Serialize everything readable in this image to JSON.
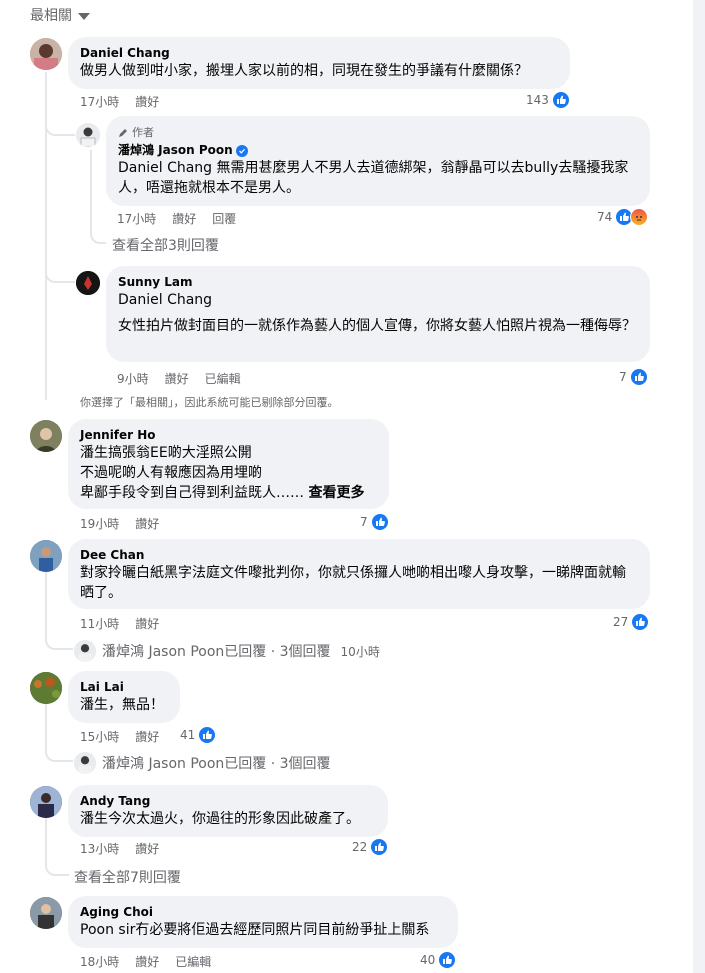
{
  "sort": {
    "label": "最相關"
  },
  "comments": [
    {
      "name": "Daniel Chang",
      "text": "做男人做到咁小家，搬埋人家以前的相，同現在發生的爭議有什麼關係？",
      "time": "17小時",
      "like_label": "讚好",
      "reactions": "143"
    },
    {
      "author_tag": "作者",
      "name": "潘焯鴻 Jason Poon",
      "text": "Daniel Chang 無需用甚麼男人不男人去道德綁架，翁靜晶可以去bully去騷擾我家人，唔還拖就根本不是男人。",
      "time": "17小時",
      "like_label": "讚好",
      "reply_label": "回覆",
      "reactions": "74"
    },
    {
      "view_replies": "查看全部3則回覆"
    },
    {
      "name": "Sunny Lam",
      "mention": "Daniel Chang",
      "text": "女性拍片做封面目的一就係作為藝人的個人宣傳，你將女藝人怕照片視為一種侮辱？",
      "time": "9小時",
      "like_label": "讚好",
      "edited": "已編輯",
      "reactions": "7"
    },
    {
      "notice": "你選擇了「最相關」，因此系統可能已剔除部分回覆。"
    },
    {
      "name": "Jennifer Ho",
      "line1": "潘生搞張翁EE啲大淫照公開",
      "line2": "不過呢啲人有報應因為用埋啲",
      "line3": "卑鄙手段令到自己得到利益既人……",
      "see_more": "查看更多",
      "time": "19小時",
      "like_label": "讚好",
      "reactions": "7"
    },
    {
      "name": "Dee Chan",
      "text": "對家拎曬白紙黑字法庭文件嚟批判你，你就只係攞人哋啲相出嚟人身攻擊，一睇牌面就輸晒了。",
      "time": "11小時",
      "like_label": "讚好",
      "reactions": "27",
      "reply_summary": "潘焯鴻 Jason Poon已回覆 · 3個回覆",
      "reply_time": "10小時"
    },
    {
      "name": "Lai Lai",
      "text": "潘生，無品！",
      "time": "15小時",
      "like_label": "讚好",
      "reactions": "41",
      "reply_summary": "潘焯鴻 Jason Poon已回覆 · 3個回覆"
    },
    {
      "name": "Andy Tang",
      "text": "潘生今次太過火，你過往的形象因此破產了。",
      "time": "13小時",
      "like_label": "讚好",
      "reactions": "22",
      "view_replies": "查看全部7則回覆"
    },
    {
      "name": "Aging Choi",
      "text": "Poon sir冇必要將佢過去經歷同照片同目前紛爭扯上關系",
      "time": "18小時",
      "like_label": "讚好",
      "edited": "已編輯",
      "reactions": "40"
    }
  ],
  "icons": [
    "caret-down-icon",
    "like-icon",
    "angry-icon",
    "pencil-icon",
    "verified-icon"
  ],
  "colors": {
    "accent": "#1877f2",
    "bubble": "#f0f2f5",
    "muted": "#65676b"
  }
}
